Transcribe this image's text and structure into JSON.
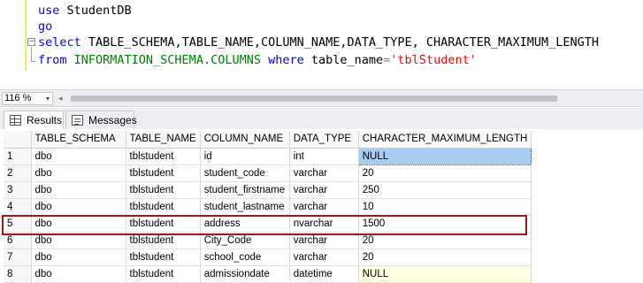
{
  "editor": {
    "lines": [
      {
        "kw": "use",
        "rest": " StudentDB"
      },
      {
        "kw": "go",
        "rest": ""
      },
      {
        "kw": "select",
        "rest": " TABLE_SCHEMA,TABLE_NAME,COLUMN_NAME,DATA_TYPE, CHARACTER_MAXIMUM_LENGTH"
      },
      {
        "kw": "from",
        "sys": " INFORMATION_SCHEMA.COLUMNS",
        "kw2": " where",
        "plain": " table_name",
        "op": "=",
        "str": "'tblStudent'"
      }
    ],
    "collapse_symbol": "−"
  },
  "zoom": {
    "value": "116 %",
    "caret": "▾",
    "scroll_left": "◂"
  },
  "tabs": [
    {
      "label": "Results",
      "active": true,
      "icon": "grid-icon"
    },
    {
      "label": "Messages",
      "active": false,
      "icon": "messages-icon"
    }
  ],
  "grid": {
    "columns": [
      "",
      "TABLE_SCHEMA",
      "TABLE_NAME",
      "COLUMN_NAME",
      "DATA_TYPE",
      "CHARACTER_MAXIMUM_LENGTH"
    ],
    "rows": [
      [
        "1",
        "dbo",
        "tblstudent",
        "id",
        "int",
        "NULL"
      ],
      [
        "2",
        "dbo",
        "tblstudent",
        "student_code",
        "varchar",
        "20"
      ],
      [
        "3",
        "dbo",
        "tblstudent",
        "student_firstname",
        "varchar",
        "250"
      ],
      [
        "4",
        "dbo",
        "tblstudent",
        "student_lastname",
        "varchar",
        "10"
      ],
      [
        "5",
        "dbo",
        "tblstudent",
        "address",
        "nvarchar",
        "1500"
      ],
      [
        "6",
        "dbo",
        "tblstudent",
        "City_Code",
        "varchar",
        "20"
      ],
      [
        "7",
        "dbo",
        "tblstudent",
        "school_code",
        "varchar",
        "20"
      ],
      [
        "8",
        "dbo",
        "tblstudent",
        "admissiondate",
        "datetime",
        "NULL"
      ]
    ],
    "selected_cell": {
      "row": 0,
      "col": 5
    },
    "highlighted_row": 4
  },
  "colors": {
    "keyword": "#0000ff",
    "system": "#008000",
    "string": "#ff0000",
    "highlight": "#a31515",
    "null_bg": "#ffffe1",
    "selected_bg": "#a8cdf0"
  }
}
